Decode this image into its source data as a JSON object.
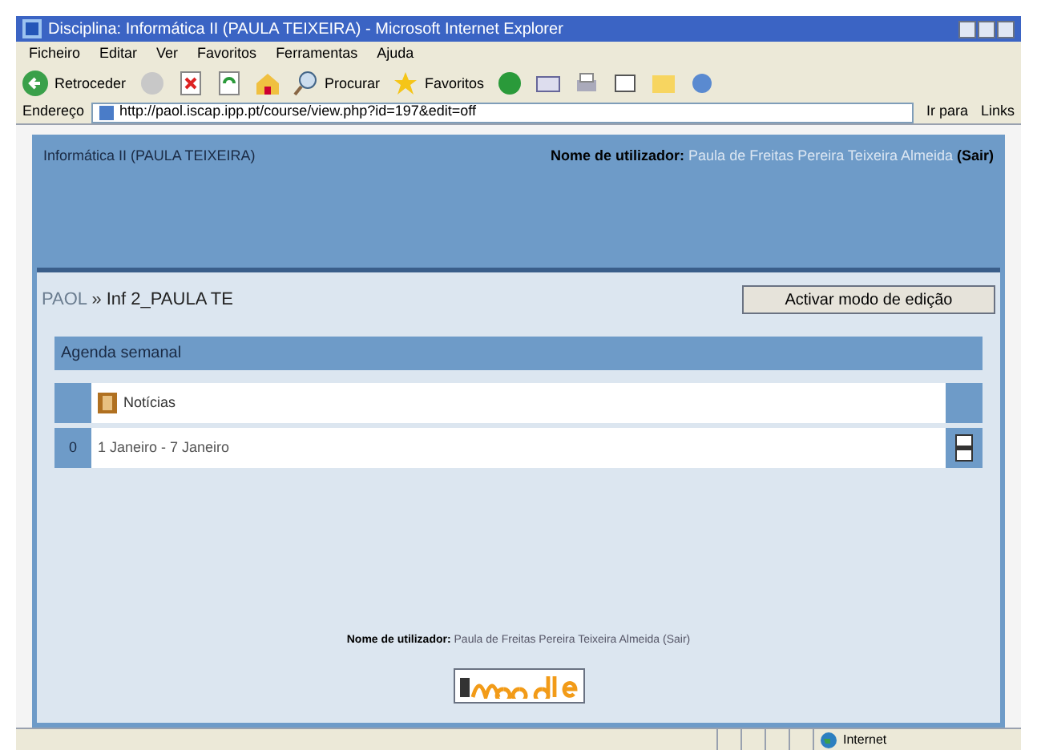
{
  "window": {
    "title": "Disciplina: Informática II (PAULA TEIXEIRA) - Microsoft Internet Explorer"
  },
  "menu": [
    "Ficheiro",
    "Editar",
    "Ver",
    "Favoritos",
    "Ferramentas",
    "Ajuda"
  ],
  "toolbar": {
    "back": "Retroceder",
    "search": "Procurar",
    "favorites": "Favoritos"
  },
  "address_bar": {
    "label": "Endereço",
    "value": "http://paol.iscap.ipp.pt/course/view.php?id=197&edit=off",
    "go": "Ir para",
    "links": "Links"
  },
  "header": {
    "course": "Informática II (PAULA TEIXEIRA)",
    "login_label": "Nome de utilizador:",
    "user": "Paula de Freitas Pereira Teixeira Almeida",
    "logout": "(Sair)"
  },
  "navbar": {
    "home": "PAOL",
    "separator": "»",
    "current": "Inf 2_PAULA TE",
    "edit_button": "Activar modo de edição"
  },
  "agenda": {
    "title": "Agenda semanal",
    "rows": [
      {
        "kind": "news",
        "number": "",
        "label": "Notícias"
      },
      {
        "kind": "week",
        "number": "0",
        "label": "1 Janeiro - 7 Janeiro"
      }
    ]
  },
  "footer": {
    "login_label": "Nome de utilizador:",
    "user": "Paula de Freitas Pereira Teixeira Almeida",
    "logout": "(Sair)"
  },
  "status_bar": {
    "zone": "Internet"
  }
}
